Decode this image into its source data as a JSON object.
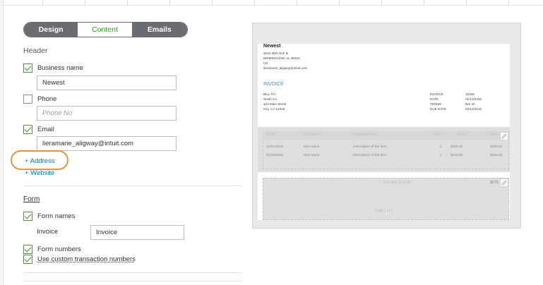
{
  "tabs": {
    "design": "Design",
    "content": "Content",
    "emails": "Emails"
  },
  "header": {
    "title": "Header",
    "business_name": {
      "label": "Business name",
      "value": "Newest",
      "checked": true
    },
    "phone": {
      "label": "Phone",
      "placeholder": "Phone No",
      "checked": false
    },
    "email": {
      "label": "Email",
      "value": "lieramarie_aligway@intuit.com",
      "checked": true
    },
    "add_address": "+ Address",
    "add_website": "+ Website"
  },
  "form": {
    "title": "Form",
    "form_names": {
      "label": "Form names",
      "checked": true
    },
    "invoice_label": "Invoice",
    "invoice_value": "Invoice",
    "form_numbers": {
      "label": "Form numbers",
      "checked": true
    },
    "custom_numbers": {
      "label": "Use custom transaction numbers",
      "checked": true
    }
  },
  "preview": {
    "company": "Newest",
    "address_lines": [
      "2510 2ND AVE N",
      "BIRMINGHAM, AL 35203",
      "US",
      "lieramarie_aligway@intuit.com"
    ],
    "doc_title": "INVOICE",
    "bill_to": [
      "BILL TO",
      "Smith Co.",
      "123 Main Street",
      "City, CA 12345"
    ],
    "meta_labels": [
      "INVOICE",
      "DATE",
      "TERMS",
      "DUE DATE"
    ],
    "meta_values": [
      "12345",
      "01/12/2016",
      "Net 30",
      "02/12/2016"
    ],
    "table_headers": [
      "DATE",
      "ACTIVITY",
      "DESCRIPTION",
      "QTY",
      "RATE",
      "AMO"
    ],
    "rows": [
      [
        "12/01/2016",
        "Item name",
        "Description of the item",
        "2",
        "$225.00",
        "$450.00"
      ],
      [
        "01/12/2016",
        "Item name",
        "Description of the item",
        "1",
        "$225.00",
        "$225.00"
      ]
    ],
    "balance_due_label": "BALANCE DUE",
    "balance_due_value": "$675",
    "page_label": "Page 1 of 1"
  },
  "colors": {
    "accent_green": "#2ca01c",
    "link_blue": "#0077c5",
    "highlight_orange": "#e8923a",
    "tab_gray": "#6b6c72"
  }
}
